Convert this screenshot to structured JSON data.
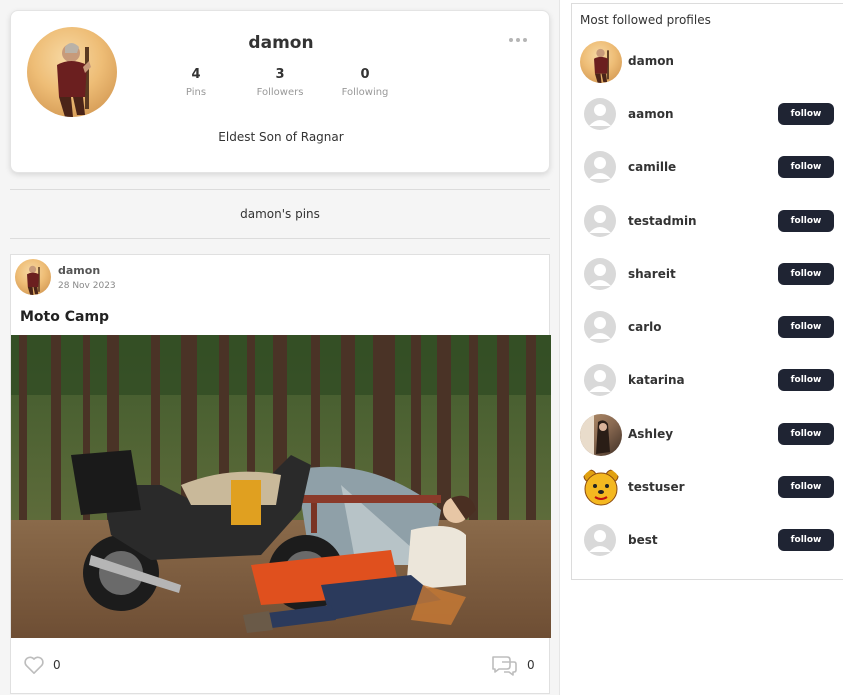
{
  "profile": {
    "name": "damon",
    "bio": "Eldest Son of Ragnar",
    "stats": {
      "pins_count": "4",
      "pins_label": "Pins",
      "followers_count": "3",
      "followers_label": "Followers",
      "following_count": "0",
      "following_label": "Following"
    }
  },
  "pins_section": {
    "title": "damon's pins"
  },
  "post": {
    "author": "damon",
    "date": "28 Nov 2023",
    "title": "Moto Camp",
    "likes": "0",
    "comments": "0"
  },
  "sidebar": {
    "title": "Most followed profiles",
    "profiles": [
      {
        "name": "damon",
        "avatar": "photo-damon",
        "has_follow": false
      },
      {
        "name": "aamon",
        "avatar": "default",
        "follow_label": "follow"
      },
      {
        "name": "camille",
        "avatar": "default",
        "follow_label": "follow"
      },
      {
        "name": "testadmin",
        "avatar": "default",
        "follow_label": "follow"
      },
      {
        "name": "shareit",
        "avatar": "default",
        "follow_label": "follow"
      },
      {
        "name": "carlo",
        "avatar": "default",
        "follow_label": "follow"
      },
      {
        "name": "katarina",
        "avatar": "default",
        "follow_label": "follow"
      },
      {
        "name": "Ashley",
        "avatar": "photo-ashley",
        "follow_label": "follow"
      },
      {
        "name": "testuser",
        "avatar": "photo-pooh",
        "follow_label": "follow"
      },
      {
        "name": "best",
        "avatar": "default",
        "follow_label": "follow"
      }
    ]
  },
  "icons": {
    "more": "more-horizontal-icon",
    "like": "heart-icon",
    "comment": "comment-icon",
    "default_avatar": "user-silhouette-icon"
  },
  "colors": {
    "follow_button": "#1f2433",
    "card_border": "#e4e4e4"
  }
}
